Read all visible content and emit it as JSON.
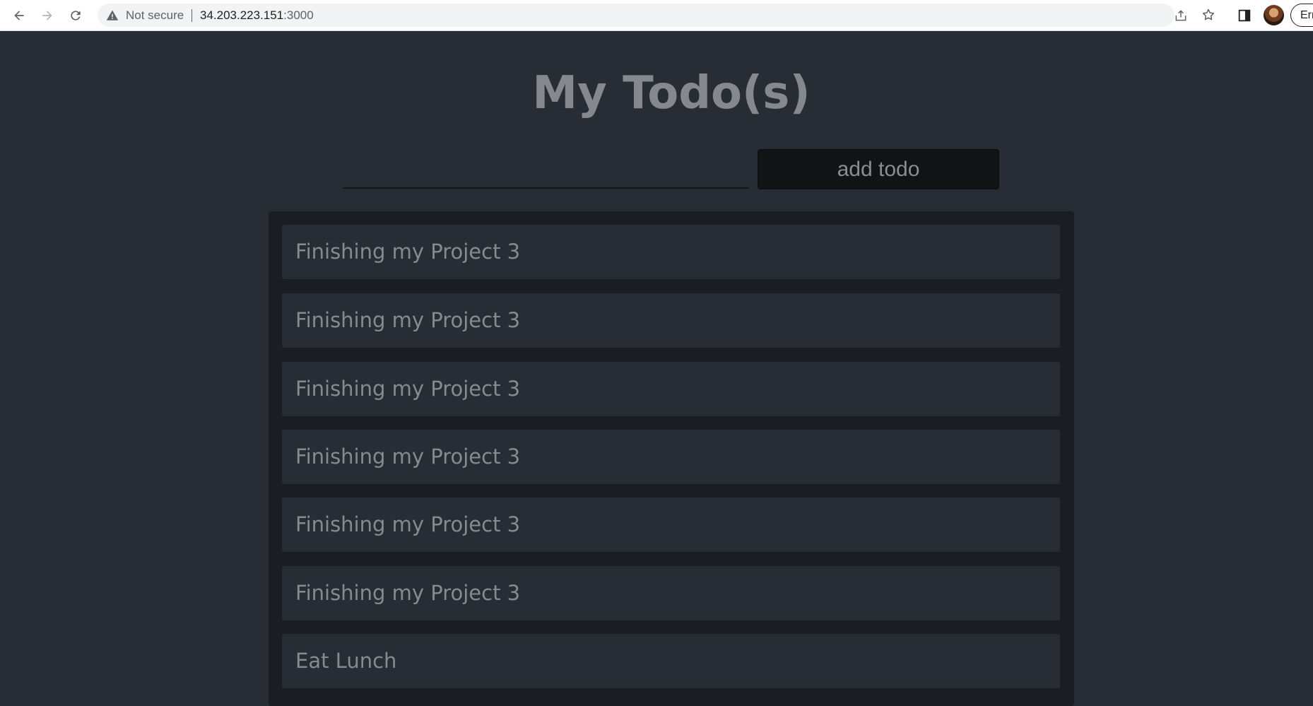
{
  "browser": {
    "security_label": "Not secure",
    "url_host": "34.203.223.151",
    "url_port": ":3000",
    "profile_label": "Err"
  },
  "app": {
    "title": "My Todo(s)",
    "input_value": "",
    "add_button_label": "add todo"
  },
  "todos": [
    {
      "text": "Finishing my Project 3"
    },
    {
      "text": "Finishing my Project 3"
    },
    {
      "text": "Finishing my Project 3"
    },
    {
      "text": "Finishing my Project 3"
    },
    {
      "text": "Finishing my Project 3"
    },
    {
      "text": "Finishing my Project 3"
    },
    {
      "text": "Eat Lunch"
    }
  ],
  "colors": {
    "page_bg": "#282c34",
    "panel_bg": "#1a1d21",
    "button_bg": "#111315",
    "text_muted": "#868a91"
  }
}
